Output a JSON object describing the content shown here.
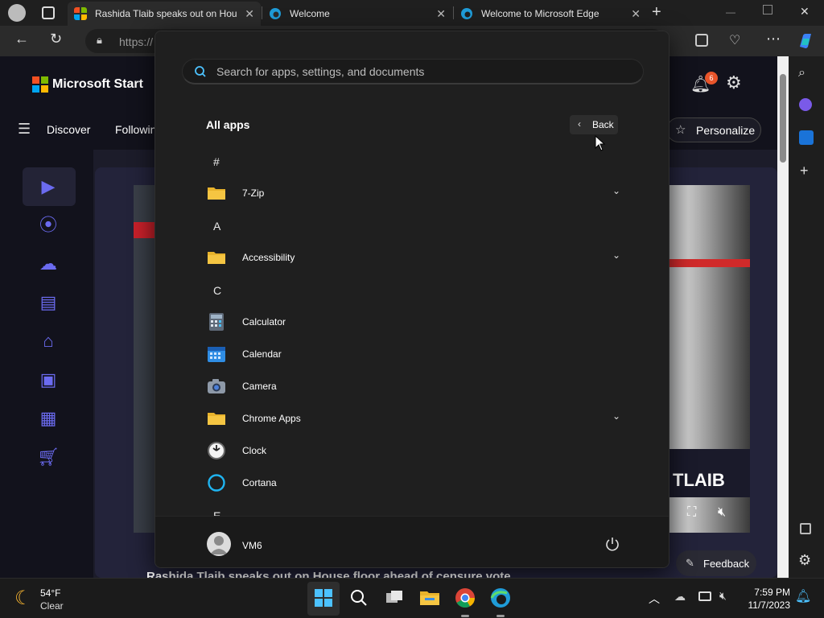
{
  "browser": {
    "tabs": [
      {
        "label": "Rashida Tlaib speaks out on Hou",
        "active": true
      },
      {
        "label": "Welcome",
        "active": false
      },
      {
        "label": "Welcome to Microsoft Edge",
        "active": false
      }
    ],
    "url_text": "https://"
  },
  "msn": {
    "logo_text": "Microsoft Start",
    "notification_count": "6",
    "nav": [
      "Discover",
      "Followin"
    ],
    "personalize_label": "Personalize",
    "feedback_label": "Feedback",
    "video_caption": "TLAIB",
    "headline_fragment": "Rashida Tlaib speaks out on House floor ahead of censure vote"
  },
  "start_menu": {
    "search_placeholder": "Search for apps, settings, and documents",
    "title": "All apps",
    "back_label": "Back",
    "letters": [
      "#",
      "A",
      "C",
      "E"
    ],
    "apps": [
      {
        "name": "7-Zip",
        "icon": "folder-icon",
        "expandable": true
      },
      {
        "name": "Accessibility",
        "icon": "folder-icon",
        "expandable": true
      },
      {
        "name": "Calculator",
        "icon": "calculator-icon",
        "expandable": false
      },
      {
        "name": "Calendar",
        "icon": "calendar-icon",
        "expandable": false
      },
      {
        "name": "Camera",
        "icon": "camera-icon",
        "expandable": false
      },
      {
        "name": "Chrome Apps",
        "icon": "folder-icon",
        "expandable": true
      },
      {
        "name": "Clock",
        "icon": "clock-icon",
        "expandable": false
      },
      {
        "name": "Cortana",
        "icon": "cortana-icon",
        "expandable": false
      }
    ],
    "user_name": "VM6"
  },
  "taskbar": {
    "weather_temp": "54°F",
    "weather_desc": "Clear",
    "time": "7:59 PM",
    "date": "11/7/2023"
  },
  "colors": {
    "accent_blue": "#4cc2ff",
    "folder_yellow": "#f5c542",
    "msn_purple": "#6b6bf0",
    "badge_orange": "#e8552b"
  }
}
